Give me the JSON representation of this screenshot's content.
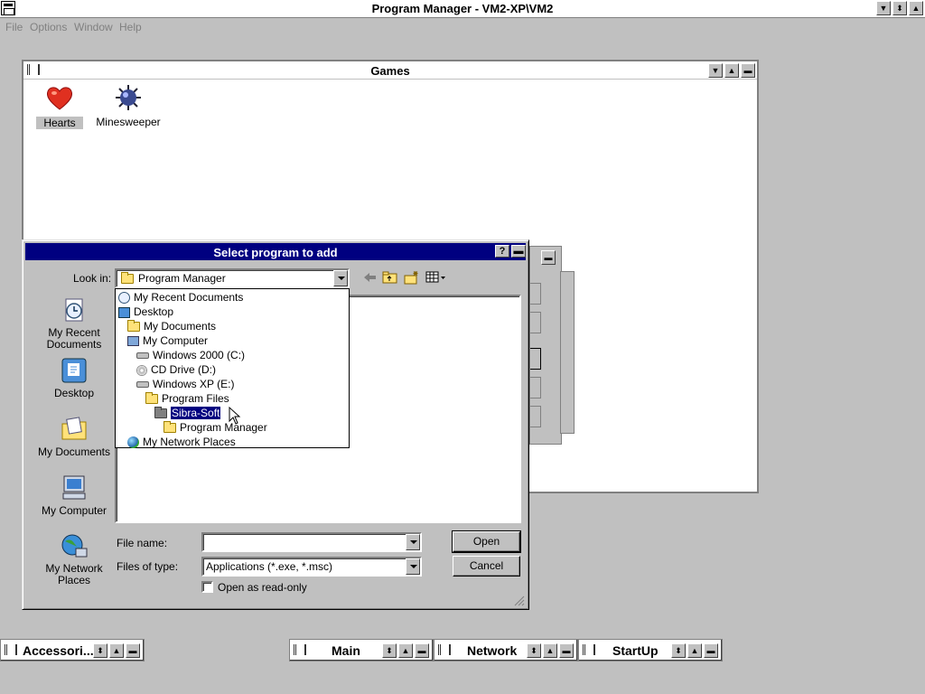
{
  "app": {
    "title": "Program Manager - VM2-XP\\VM2"
  },
  "menu": {
    "items": [
      "File",
      "Options",
      "Window",
      "Help"
    ]
  },
  "window_buttons": {
    "minimize": "▼",
    "restore": "⬍",
    "maximize": "▲"
  },
  "games": {
    "title": "Games",
    "icons": [
      {
        "label": "Hearts",
        "icon": "hearts-icon"
      },
      {
        "label": "Minesweeper",
        "icon": "minesweeper-icon"
      }
    ]
  },
  "dialog": {
    "title": "Select program to add",
    "help": "?",
    "close": "▬",
    "look_in_label": "Look in:",
    "look_in_value": "Program Manager",
    "dropdown": [
      {
        "label": "My Recent Documents",
        "icon": "recent-docs-icon",
        "indent": 0
      },
      {
        "label": "Desktop",
        "icon": "desktop-icon",
        "indent": 0
      },
      {
        "label": "My Documents",
        "icon": "folder-icon",
        "indent": 1
      },
      {
        "label": "My Computer",
        "icon": "computer-icon",
        "indent": 1
      },
      {
        "label": "Windows 2000 (C:)",
        "icon": "drive-icon",
        "indent": 2
      },
      {
        "label": "CD Drive (D:)",
        "icon": "cd-drive-icon",
        "indent": 2
      },
      {
        "label": "Windows XP (E:)",
        "icon": "drive-icon",
        "indent": 2
      },
      {
        "label": "Program Files",
        "icon": "folder-icon",
        "indent": 3
      },
      {
        "label": "Sibra-Soft",
        "icon": "folder-icon",
        "indent": 4,
        "selected": true
      },
      {
        "label": "Program Manager",
        "icon": "folder-icon",
        "indent": 5
      },
      {
        "label": "My Network Places",
        "icon": "network-icon",
        "indent": 1
      }
    ],
    "places": [
      {
        "label": "My Recent Documents",
        "icon": "recent-docs-icon"
      },
      {
        "label": "Desktop",
        "icon": "desktop-icon"
      },
      {
        "label": "My Documents",
        "icon": "my-documents-icon"
      },
      {
        "label": "My Computer",
        "icon": "my-computer-icon"
      },
      {
        "label": "My Network Places",
        "icon": "network-places-icon"
      }
    ],
    "file_name_label": "File name:",
    "file_name_value": "",
    "file_type_label": "Files of type:",
    "file_type_value": "Applications (*.exe, *.msc)",
    "readonly_label": "Open as read-only",
    "readonly_checked": false,
    "open_button": "Open",
    "cancel_button": "Cancel"
  },
  "minimized_groups": [
    {
      "label": "Accessori..."
    },
    {
      "label": "Main"
    },
    {
      "label": "Network"
    },
    {
      "label": "StartUp"
    }
  ]
}
